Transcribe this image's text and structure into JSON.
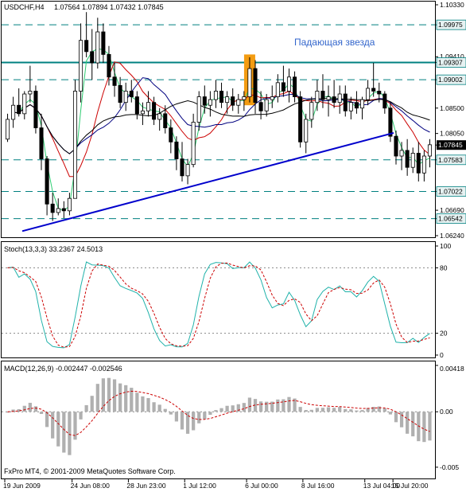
{
  "window": {
    "symbol_header": "USDCHF,H4",
    "ohlc_header": "1.07564 1.07894 1.07432 1.07845",
    "annotation": "Падающая звезда",
    "stoch_header": "Stoch(13,3,3) 33.2367 24.5013",
    "macd_header": "MACD(12,26,9) -0.002447 -0.002546",
    "footer_brand": "FxPro MT4, © 2001-2009 MetaQuotes Software Corp."
  },
  "colors": {
    "background": "#ffffff",
    "candle": "#000000",
    "ma_fast": "#2ecc71",
    "ma_mid": "#cc0000",
    "ma_slow": "#000080",
    "ma_long": "#000000",
    "trendline": "#0000cc",
    "level": "#008080",
    "highlight": "#f39c12",
    "stoch_main": "#20b2aa",
    "stoch_signal": "#cc0000",
    "macd_hist": "#b0b0b0",
    "macd_signal": "#cc0000",
    "annotation_text": "#3366cc"
  },
  "price_axis": {
    "labels": [
      "1.10330",
      "1.09975",
      "1.09410",
      "1.09307",
      "1.09002",
      "1.08500",
      "1.08050",
      "1.07845",
      "1.07583",
      "1.07022",
      "1.06690",
      "1.06542",
      "1.06240"
    ],
    "current": "1.07845",
    "marked_levels": [
      "1.09975",
      "1.09307",
      "1.09002",
      "1.07583",
      "1.07022",
      "1.06542"
    ]
  },
  "stoch_axis": {
    "labels": [
      "100",
      "80",
      "20",
      "0"
    ]
  },
  "macd_axis": {
    "labels": [
      "0.00418",
      "0.00",
      "-0.005"
    ]
  },
  "time_axis": {
    "labels": [
      "19 Jun 2009",
      "24 Jun 08:00",
      "28 Jun 23:00",
      "1 Jul 12:00",
      "6 Jul 00:00",
      "8 Jul 16:00",
      "13 Jul 04:00",
      "15 Jul 20:00"
    ]
  },
  "chart_data": {
    "type": "candlestick",
    "symbol": "USDCHF",
    "timeframe": "H4",
    "ylim": [
      1.0624,
      1.1033
    ],
    "candles": [
      [
        1.0795,
        1.084,
        1.079,
        1.083
      ],
      [
        1.083,
        1.087,
        1.0815,
        1.0855
      ],
      [
        1.0855,
        1.0885,
        1.0835,
        1.084
      ],
      [
        1.084,
        1.088,
        1.083,
        1.0875
      ],
      [
        1.0875,
        1.0925,
        1.086,
        1.088
      ],
      [
        1.088,
        1.089,
        1.0805,
        1.0815
      ],
      [
        1.0815,
        1.084,
        1.074,
        1.076
      ],
      [
        1.076,
        1.0765,
        1.066,
        1.068
      ],
      [
        1.068,
        1.07,
        1.065,
        1.0665
      ],
      [
        1.0665,
        1.069,
        1.066,
        1.0672
      ],
      [
        1.0672,
        1.0685,
        1.0655,
        1.0668
      ],
      [
        1.0668,
        1.07,
        1.066,
        1.069
      ],
      [
        1.069,
        1.09,
        1.069,
        1.088
      ],
      [
        1.088,
        1.1,
        1.086,
        1.097
      ],
      [
        1.097,
        1.102,
        1.094,
        1.095
      ],
      [
        1.095,
        1.099,
        1.09,
        1.093
      ],
      [
        1.093,
        1.101,
        1.092,
        1.0985
      ],
      [
        1.0985,
        1.1,
        1.093,
        1.0945
      ],
      [
        1.0945,
        1.096,
        1.089,
        1.0905
      ],
      [
        1.0905,
        1.093,
        1.087,
        1.089
      ],
      [
        1.089,
        1.0905,
        1.085,
        1.086
      ],
      [
        1.086,
        1.0895,
        1.0845,
        1.088
      ],
      [
        1.088,
        1.09,
        1.086,
        1.087
      ],
      [
        1.087,
        1.088,
        1.083,
        1.084
      ],
      [
        1.084,
        1.086,
        1.082,
        1.0845
      ],
      [
        1.0845,
        1.088,
        1.0835,
        1.086
      ],
      [
        1.086,
        1.087,
        1.082,
        1.083
      ],
      [
        1.083,
        1.085,
        1.081,
        1.084
      ],
      [
        1.084,
        1.0855,
        1.0805,
        1.0815
      ],
      [
        1.0815,
        1.083,
        1.077,
        1.079
      ],
      [
        1.079,
        1.08,
        1.074,
        1.076
      ],
      [
        1.076,
        1.079,
        1.072,
        1.073
      ],
      [
        1.073,
        1.076,
        1.0715,
        1.075
      ],
      [
        1.075,
        1.084,
        1.0745,
        1.0825
      ],
      [
        1.0825,
        1.088,
        1.081,
        1.087
      ],
      [
        1.087,
        1.089,
        1.084,
        1.0855
      ],
      [
        1.0855,
        1.088,
        1.0835,
        1.0865
      ],
      [
        1.0865,
        1.09,
        1.085,
        1.088
      ],
      [
        1.088,
        1.0895,
        1.085,
        1.086
      ],
      [
        1.086,
        1.088,
        1.084,
        1.087
      ],
      [
        1.087,
        1.0885,
        1.0845,
        1.0855
      ],
      [
        1.0855,
        1.0875,
        1.084,
        1.0865
      ],
      [
        1.0865,
        1.088,
        1.0845,
        1.087
      ],
      [
        1.087,
        1.094,
        1.086,
        1.092
      ],
      [
        1.092,
        1.0935,
        1.084,
        1.086
      ],
      [
        1.086,
        1.088,
        1.083,
        1.0845
      ],
      [
        1.0845,
        1.0875,
        1.0835,
        1.0865
      ],
      [
        1.0865,
        1.089,
        1.085,
        1.087
      ],
      [
        1.087,
        1.091,
        1.086,
        1.0895
      ],
      [
        1.0895,
        1.0925,
        1.087,
        1.088
      ],
      [
        1.088,
        1.092,
        1.086,
        1.0905
      ],
      [
        1.0905,
        1.0915,
        1.086,
        1.087
      ],
      [
        1.087,
        1.088,
        1.078,
        1.079
      ],
      [
        1.079,
        1.084,
        1.077,
        1.083
      ],
      [
        1.083,
        1.087,
        1.0815,
        1.086
      ],
      [
        1.086,
        1.09,
        1.0845,
        1.088
      ],
      [
        1.088,
        1.091,
        1.085,
        1.0865
      ],
      [
        1.0865,
        1.089,
        1.0835,
        1.087
      ],
      [
        1.087,
        1.09,
        1.085,
        1.086
      ],
      [
        1.086,
        1.089,
        1.084,
        1.0875
      ],
      [
        1.0875,
        1.089,
        1.0835,
        1.0845
      ],
      [
        1.0845,
        1.087,
        1.083,
        1.086
      ],
      [
        1.086,
        1.088,
        1.084,
        1.085
      ],
      [
        1.085,
        1.087,
        1.083,
        1.0865
      ],
      [
        1.0865,
        1.09,
        1.0855,
        1.0885
      ],
      [
        1.0885,
        1.093,
        1.087,
        1.088
      ],
      [
        1.088,
        1.0895,
        1.086,
        1.0875
      ],
      [
        1.0875,
        1.088,
        1.084,
        1.085
      ],
      [
        1.085,
        1.086,
        1.079,
        1.08
      ],
      [
        1.08,
        1.081,
        1.075,
        1.0765
      ],
      [
        1.0765,
        1.079,
        1.074,
        1.0775
      ],
      [
        1.0775,
        1.0795,
        1.073,
        1.0745
      ],
      [
        1.0745,
        1.078,
        1.0735,
        1.077
      ],
      [
        1.077,
        1.079,
        1.072,
        1.0735
      ],
      [
        1.0735,
        1.0775,
        1.072,
        1.0765
      ],
      [
        1.0765,
        1.0795,
        1.0745,
        1.0785
      ]
    ]
  }
}
